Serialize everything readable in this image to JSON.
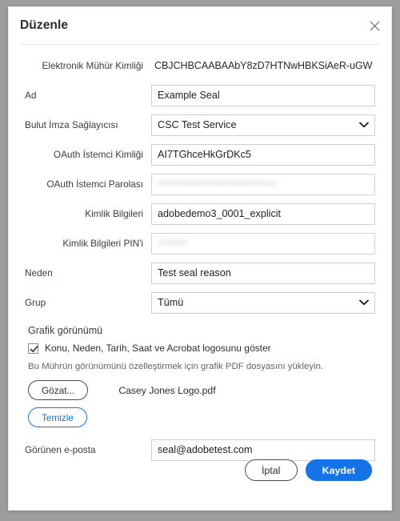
{
  "dialog": {
    "title": "Düzenle",
    "close_icon": "close-icon"
  },
  "fields": {
    "seal_id": {
      "label": "Elektronik Mühür Kimliği",
      "value": "CBJCHBCAABAAbY8zD7HTNwHBKSiAeR-uGW"
    },
    "name": {
      "label": "Ad",
      "value": "Example Seal"
    },
    "provider": {
      "label": "Bulut İmza Sağlayıcısı",
      "value": "CSC Test Service"
    },
    "oauth_client_id": {
      "label": "OAuth İstemci Kimliği",
      "value": "AI7TGhceHkGrDKc5"
    },
    "oauth_client_secret": {
      "label": "OAuth İstemci Parolası",
      "value": "••••••••••••••••••••••••••••••••"
    },
    "credential_id": {
      "label": "Kimlik Bilgileri",
      "value": "adobedemo3_0001_explicit"
    },
    "credential_pin": {
      "label": "Kimlik Bilgileri PIN'i",
      "value": "••••••••"
    },
    "reason": {
      "label": "Neden",
      "value": "Test seal reason"
    },
    "group": {
      "label": "Grup",
      "value": "Tümü"
    },
    "display_email": {
      "label": "Görünen e-posta",
      "value": "seal@adobetest.com"
    }
  },
  "appearance": {
    "section_title": "Grafik görünümü",
    "checkbox_label": "Konu, Neden, Tarih, Saat ve Acrobat logosunu göster",
    "checkbox_checked": true,
    "hint": "Bu Mührün görünümünü özelleştirmek için grafik PDF dosyasını yükleyin.",
    "browse_label": "Gözat...",
    "clear_label": "Temizle",
    "filename": "Casey Jones Logo.pdf"
  },
  "footer": {
    "cancel_label": "İptal",
    "save_label": "Kaydet"
  },
  "colors": {
    "accent": "#1473e6",
    "backdrop": "#9d9d9d",
    "border": "#cfcfcf"
  }
}
